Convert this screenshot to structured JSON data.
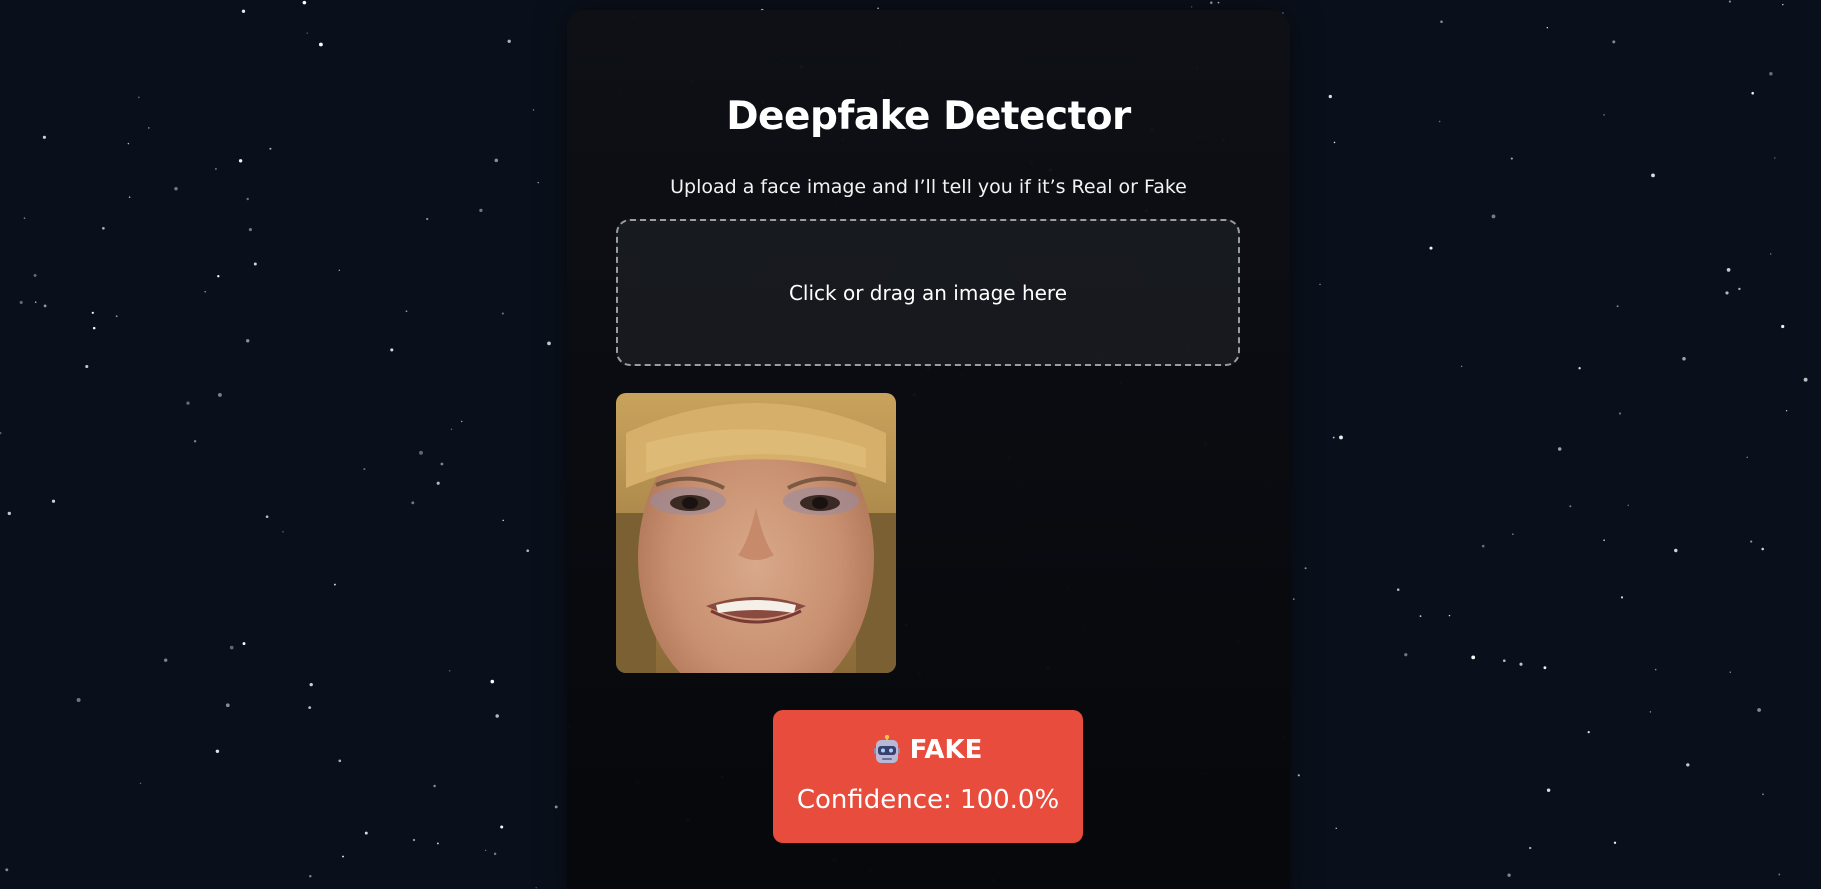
{
  "app": {
    "title": "Deepfake Detector",
    "subtitle": "Upload a face image and I’ll tell you if it’s Real or Fake"
  },
  "upload": {
    "prompt": "Click or drag an image here"
  },
  "preview": {
    "alt": "uploaded face image"
  },
  "result": {
    "icon": "robot-icon",
    "label": "FAKE",
    "confidence_text": "Confidence: 100.0%",
    "confidence_value": 100.0,
    "color": "#e74c3c"
  },
  "theme": {
    "background": "#0a101b",
    "card": "#0b0d12",
    "accent_fake": "#e74c3c"
  }
}
